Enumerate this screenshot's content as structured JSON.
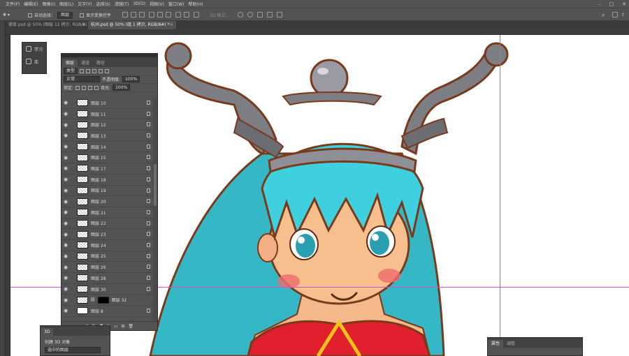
{
  "menu": [
    "文件(F)",
    "编辑(E)",
    "图像(I)",
    "图层(L)",
    "文字(Y)",
    "选择(S)",
    "滤镜(T)",
    "3D(D)",
    "视图(V)",
    "窗口(W)",
    "帮助(H)"
  ],
  "options_bar": {
    "auto_select_label": "自动选择：",
    "auto_select_value": "图层",
    "show_transform_label": "显示变换控件",
    "mode_3d_label": "3D 模式："
  },
  "tabs": [
    {
      "label": "德育.psd @ 50% (图层 12 拷贝, RGB/8)",
      "active": false
    },
    {
      "label": "杭州.psd @ 50% (组 1 拷贝, RGB/8#) *",
      "active": true
    }
  ],
  "learn_panel": {
    "learn_label": "学习",
    "library_label": "库"
  },
  "layers_panel": {
    "tabs": [
      "图层",
      "通道",
      "路径"
    ],
    "filter_kind": "类型",
    "blend_mode": "正常",
    "opacity_label": "不透明度:",
    "opacity_value": "100%",
    "lock_label": "锁定:",
    "fill_label": "填充:",
    "fill_value": "100%",
    "layers": [
      {
        "name": "图层 10",
        "thumb": "transparent"
      },
      {
        "name": "图层 11",
        "thumb": "transparent"
      },
      {
        "name": "图层 12",
        "thumb": "transparent"
      },
      {
        "name": "图层 13",
        "thumb": "transparent"
      },
      {
        "name": "图层 14",
        "thumb": "transparent"
      },
      {
        "name": "图层 15",
        "thumb": "transparent"
      },
      {
        "name": "图层 17",
        "thumb": "transparent"
      },
      {
        "name": "图层 18",
        "thumb": "transparent"
      },
      {
        "name": "图层 19",
        "thumb": "transparent"
      },
      {
        "name": "图层 20",
        "thumb": "transparent"
      },
      {
        "name": "图层 21",
        "thumb": "transparent"
      },
      {
        "name": "图层 22",
        "thumb": "transparent"
      },
      {
        "name": "图层 23",
        "thumb": "transparent"
      },
      {
        "name": "图层 24",
        "thumb": "transparent"
      },
      {
        "name": "图层 25",
        "thumb": "transparent"
      },
      {
        "name": "图层 26",
        "thumb": "transparent"
      },
      {
        "name": "图层 28",
        "thumb": "transparent"
      },
      {
        "name": "图层 30",
        "thumb": "transparent"
      },
      {
        "name": "图层 32",
        "thumb": "black"
      },
      {
        "name": "图层 8",
        "thumb": "white"
      }
    ],
    "footer_fx": "fx"
  },
  "panel_3d": {
    "tab": "3D",
    "create_label": "创建 3D 对象",
    "source_label": "选中的图层"
  },
  "properties_panel": {
    "tabs": [
      "属性",
      "调整"
    ]
  },
  "colors": {
    "guide": "#d452d4",
    "hair": "#3fd0df",
    "crown": "#7d7d84",
    "outline": "#7a3a1a",
    "dress": "#e0202d"
  }
}
